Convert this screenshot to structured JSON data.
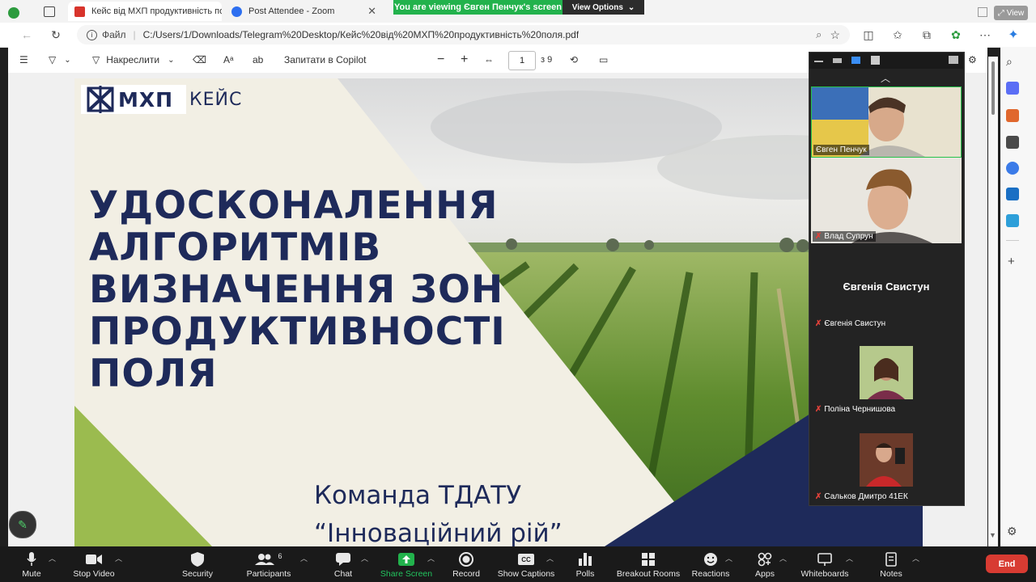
{
  "browser": {
    "tabs": [
      {
        "title": "Кейс від МХП продуктивність по"
      },
      {
        "title": "Post Attendee - Zoom"
      }
    ],
    "address_label": "Файл",
    "url": "C:/Users/1/Downloads/Telegram%20Desktop/Кейс%20від%20МХП%20продуктивність%20поля.pdf",
    "view_chip": "View"
  },
  "zoom_share": {
    "banner": "You are viewing Євген Пенчук's screen",
    "view_options": "View Options"
  },
  "pdf_toolbar": {
    "draw_label": "Накреслити",
    "copilot_label": "Запитати в Copilot",
    "page_current": "1",
    "page_total": "з 9"
  },
  "slide": {
    "logo_text": "МХП",
    "logo_suffix": "КЕЙС",
    "title_lines": [
      "УДОСКОНАЛЕННЯ",
      "АЛГОРИТМІВ",
      "ВИЗНАЧЕННЯ ЗОН",
      "ПРОДУКТИВНОСТІ",
      "ПОЛЯ"
    ],
    "team_line1": "Команда ТДАТУ",
    "team_line2": "“Інноваційний рій”"
  },
  "gallery": {
    "participants": [
      {
        "name": "Євген Пенчук",
        "muted": false
      },
      {
        "name": "Влад Супрун",
        "muted": true
      },
      {
        "name": "Євгенія Свистун",
        "muted": true,
        "center_label": "Євгенія Свистун"
      },
      {
        "name": "Поліна Чернишова",
        "muted": true
      },
      {
        "name": "Сальков Дмитро 41ЕК",
        "muted": true
      }
    ]
  },
  "zoom_toolbar": {
    "mute": "Mute",
    "stop_video": "Stop Video",
    "security": "Security",
    "participants": "Participants",
    "participants_count": "6",
    "chat": "Chat",
    "share_screen": "Share Screen",
    "record": "Record",
    "show_captions": "Show Captions",
    "polls": "Polls",
    "breakout_rooms": "Breakout Rooms",
    "reactions": "Reactions",
    "apps": "Apps",
    "whiteboards": "Whiteboards",
    "notes": "Notes",
    "end": "End"
  },
  "colors": {
    "accent_green": "#22b24c",
    "slide_navy": "#1e2a5a",
    "slide_olive": "#9bbb4f",
    "end_red": "#d83b32"
  }
}
